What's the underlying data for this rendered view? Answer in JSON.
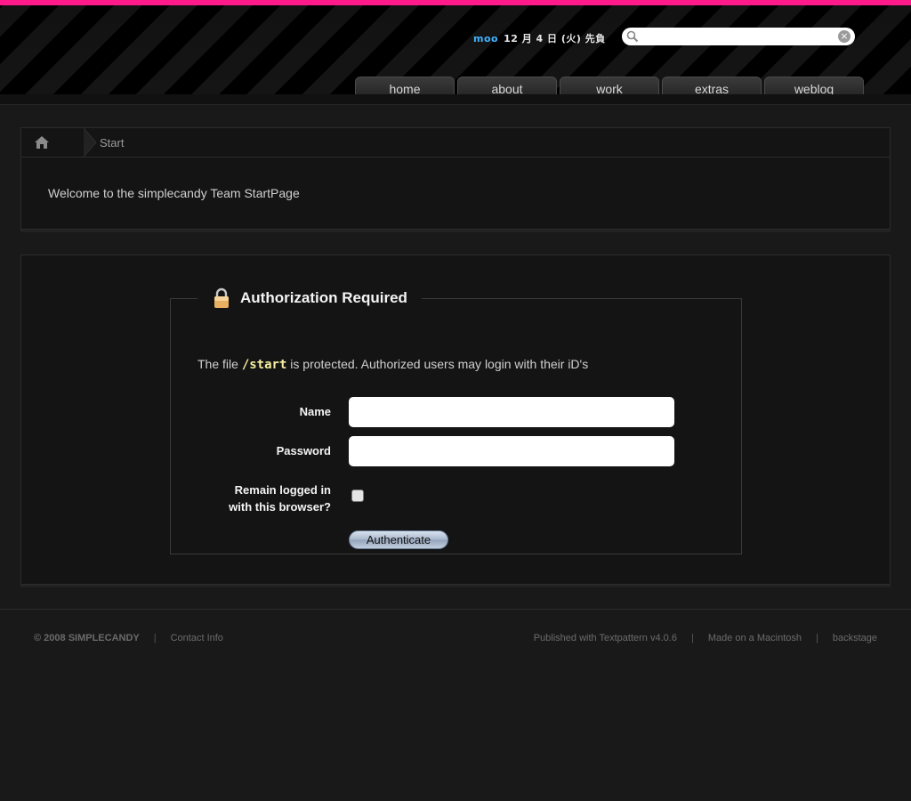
{
  "header": {
    "user": "moo",
    "date": "12 月 4 日 (火) 先負",
    "search": {
      "value": "",
      "placeholder": ""
    }
  },
  "nav": [
    "home",
    "about",
    "work",
    "extras",
    "weblog"
  ],
  "breadcrumb": {
    "current": "Start"
  },
  "welcome": "Welcome to the simplecandy Team StartPage",
  "auth": {
    "title": "Authorization Required",
    "message_pre": "The file ",
    "message_path": "/start",
    "message_post": " is protected. Authorized users may login with their iD's",
    "name_label": "Name",
    "password_label": "Password",
    "remain_label_1": "Remain logged in",
    "remain_label_2": "with this browser?",
    "button": "Authenticate"
  },
  "footer": {
    "copyright": "© 2008 SIMPLECANDY",
    "contact": "Contact Info",
    "published": "Published with Textpattern v4.0.6",
    "made": "Made on a Macintosh",
    "backstage": "backstage"
  },
  "colors": {
    "accent": "#ff1a8c",
    "user": "#3fb3ff",
    "path": "#f5f0a0"
  }
}
